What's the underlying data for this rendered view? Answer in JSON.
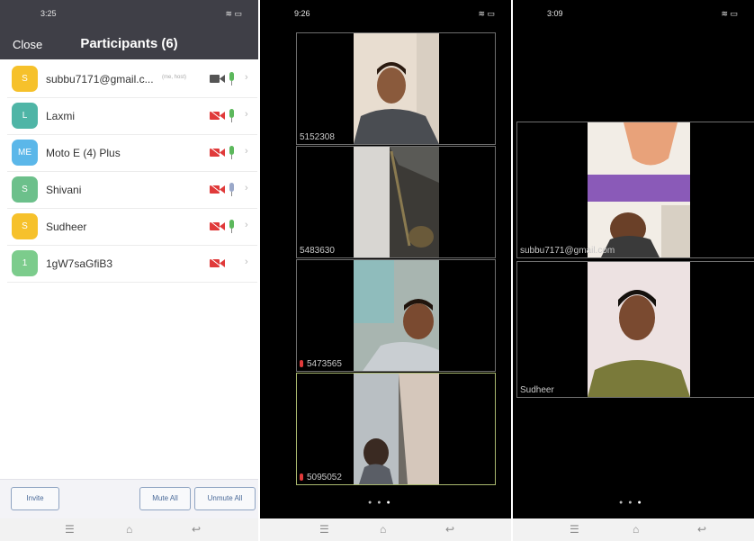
{
  "screens": [
    {
      "status": {
        "time": "3:25",
        "signal": "WiFi 80"
      },
      "header": {
        "close_label": "Close",
        "title": "Participants (6)"
      },
      "participants": [
        {
          "initials": "S",
          "name": "subbu7171@gmail.c...",
          "tag": "(me, host)",
          "color": "#f6c12b",
          "video": "on",
          "audio": "on"
        },
        {
          "initials": "L",
          "name": "Laxmi",
          "tag": "",
          "color": "#4fb5a6",
          "video": "off",
          "audio": "on"
        },
        {
          "initials": "ME",
          "name": "Moto E (4) Plus",
          "tag": "",
          "color": "#5bb7e9",
          "video": "off",
          "audio": "on"
        },
        {
          "initials": "S",
          "name": "Shivani",
          "tag": "",
          "color": "#6cc08b",
          "video": "off",
          "audio": "on"
        },
        {
          "initials": "S",
          "name": "Sudheer",
          "tag": "",
          "color": "#f6c12b",
          "video": "off",
          "audio": "on"
        },
        {
          "initials": "1",
          "name": "1gW7saGfiB3",
          "tag": "",
          "color": "#7ccc8c",
          "video": "off",
          "audio": "none"
        }
      ],
      "footer": {
        "invite_label": "Invite",
        "mute_all_label": "Mute All",
        "unmute_all_label": "Unmute All"
      }
    },
    {
      "status": {
        "time": "9:26",
        "signal": "WiFi 80"
      },
      "tiles": [
        {
          "label": "5152308",
          "muted": false,
          "active": false
        },
        {
          "label": "5483630",
          "muted": false,
          "active": false
        },
        {
          "label": "5473565",
          "muted": true,
          "active": false
        },
        {
          "label": "5095052",
          "muted": true,
          "active": true
        }
      ],
      "page_dots": 3,
      "active_dot": 3
    },
    {
      "status": {
        "time": "3:09",
        "signal": "WiFi 80"
      },
      "tiles": [
        {
          "label": "subbu7171@gmail.com"
        },
        {
          "label": "Sudheer"
        }
      ],
      "page_dots": 3,
      "active_dot": 3
    }
  ],
  "colors": {
    "header_bg": "#3f3f47",
    "video_off": "#e03a3a",
    "mic_on": "#5cb85c",
    "video_on": "#555555",
    "button_text": "#4a6a99"
  }
}
